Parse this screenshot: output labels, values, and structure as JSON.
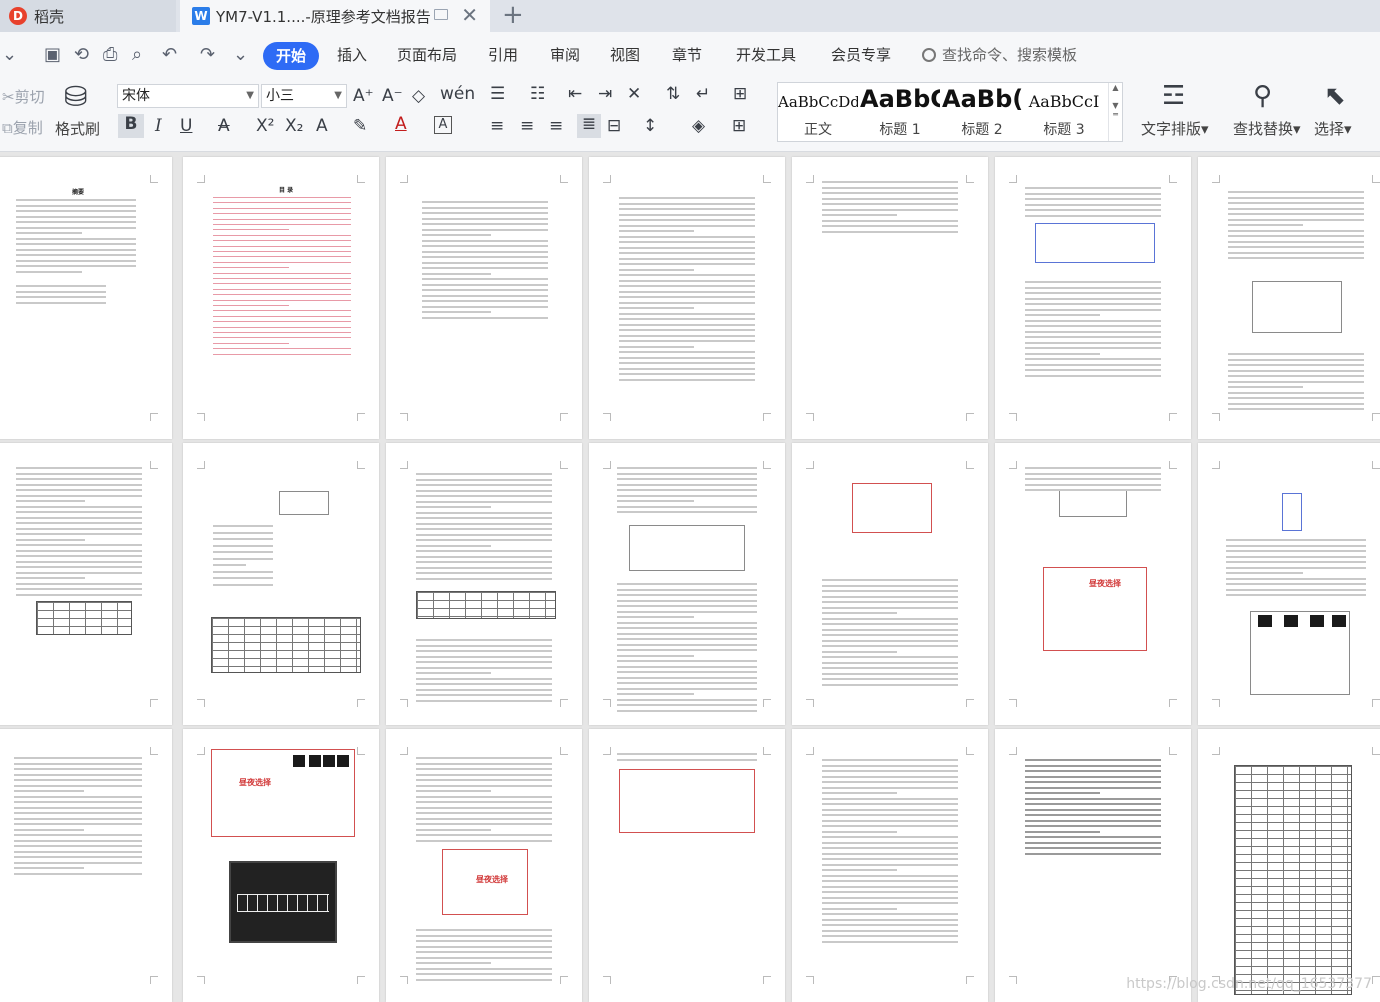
{
  "tabs": [
    {
      "label": "稻壳",
      "active": false
    },
    {
      "label": "YM7-V1.1....-原理参考文档报告",
      "active": true
    }
  ],
  "menu": {
    "items": [
      "开始",
      "插入",
      "页面布局",
      "引用",
      "审阅",
      "视图",
      "章节",
      "开发工具",
      "会员专享"
    ],
    "active": "开始",
    "search_placeholder": "查找命令、搜索模板"
  },
  "ribbon": {
    "cut": "剪切",
    "copy": "复制",
    "format_painter": "格式刷",
    "font_name": "宋体",
    "font_size": "小三",
    "styles": [
      {
        "sample": "AaBbCcDd",
        "name": "正文"
      },
      {
        "sample": "AaBbC",
        "name": "标题 1"
      },
      {
        "sample": "AaBb(",
        "name": "标题 2"
      },
      {
        "sample": "AaBbCcI",
        "name": "标题 3"
      }
    ],
    "text_layout": "文字排版",
    "find_replace": "查找替换",
    "select": "选择"
  },
  "pages": {
    "toc_title": "目 录",
    "abstract_title": "摘要",
    "sim_label": "昼夜选择"
  },
  "watermark": "https://blog.csdn.net/qq_16537377"
}
